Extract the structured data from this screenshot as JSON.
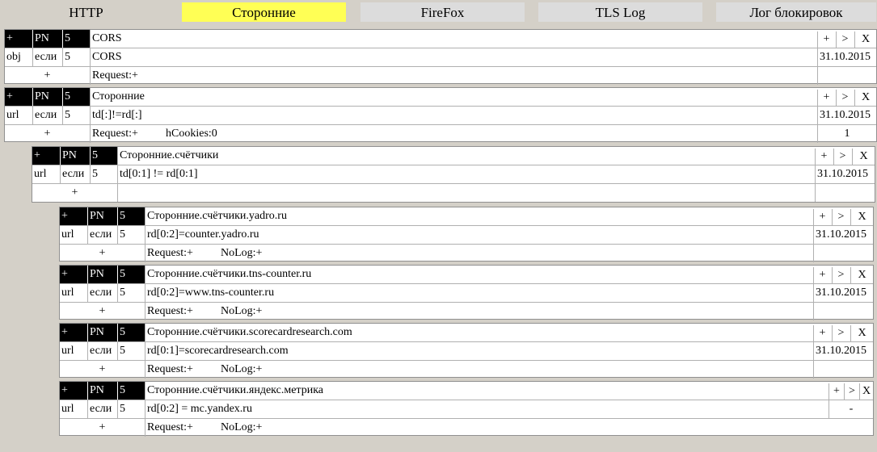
{
  "tabs": [
    {
      "label": "HTTP"
    },
    {
      "label": "Сторонние"
    },
    {
      "label": "FireFox"
    },
    {
      "label": "TLS Log"
    },
    {
      "label": "Лог блокировок"
    }
  ],
  "rules": [
    {
      "header": {
        "plus": "+",
        "pn": "PN",
        "num": "5",
        "name": "CORS",
        "btn_add": "+",
        "btn_next": ">",
        "btn_del": "X"
      },
      "cond": {
        "type": "obj",
        "op": "если",
        "num": "5",
        "expr": "CORS",
        "date": "31.10.2015"
      },
      "actions": {
        "plus": "+",
        "request": "Request:+",
        "extra": "",
        "count": ""
      }
    },
    {
      "header": {
        "plus": "+",
        "pn": "PN",
        "num": "5",
        "name": "Сторонние",
        "btn_add": "+",
        "btn_next": ">",
        "btn_del": "X"
      },
      "cond": {
        "type": "url",
        "op": "если",
        "num": "5",
        "expr": "td[:]!=rd[:]",
        "date": "31.10.2015"
      },
      "actions": {
        "plus": "+",
        "request": "Request:+",
        "extra": "hCookies:0",
        "count": "1"
      }
    },
    {
      "header": {
        "plus": "+",
        "pn": "PN",
        "num": "5",
        "name": "Сторонние.счётчики",
        "btn_add": "+",
        "btn_next": ">",
        "btn_del": "X"
      },
      "cond": {
        "type": "url",
        "op": "если",
        "num": "5",
        "expr": "td[0:1] != rd[0:1]",
        "date": "31.10.2015"
      },
      "actions": {
        "plus": "+",
        "request": "",
        "extra": "",
        "count": ""
      }
    },
    {
      "header": {
        "plus": "+",
        "pn": "PN",
        "num": "5",
        "name": "Сторонние.счётчики.yadro.ru",
        "btn_add": "+",
        "btn_next": ">",
        "btn_del": "X"
      },
      "cond": {
        "type": "url",
        "op": "если",
        "num": "5",
        "expr": "rd[0:2]=counter.yadro.ru",
        "date": "31.10.2015"
      },
      "actions": {
        "plus": "+",
        "request": "Request:+",
        "extra": "NoLog:+",
        "count": ""
      }
    },
    {
      "header": {
        "plus": "+",
        "pn": "PN",
        "num": "5",
        "name": "Сторонние.счётчики.tns-counter.ru",
        "btn_add": "+",
        "btn_next": ">",
        "btn_del": "X"
      },
      "cond": {
        "type": "url",
        "op": "если",
        "num": "5",
        "expr": "rd[0:2]=www.tns-counter.ru",
        "date": "31.10.2015"
      },
      "actions": {
        "plus": "+",
        "request": "Request:+",
        "extra": "NoLog:+",
        "count": ""
      }
    },
    {
      "header": {
        "plus": "+",
        "pn": "PN",
        "num": "5",
        "name": "Сторонние.счётчики.scorecardresearch.com",
        "btn_add": "+",
        "btn_next": ">",
        "btn_del": "X"
      },
      "cond": {
        "type": "url",
        "op": "если",
        "num": "5",
        "expr": "rd[0:1]=scorecardresearch.com",
        "date": "31.10.2015"
      },
      "actions": {
        "plus": "+",
        "request": "Request:+",
        "extra": "NoLog:+",
        "count": ""
      }
    },
    {
      "header": {
        "plus": "+",
        "pn": "PN",
        "num": "5",
        "name": "Сторонние.счётчики.яндекс.метрика",
        "btn_add": "+",
        "btn_next": ">",
        "btn_del": "X"
      },
      "cond": {
        "type": "url",
        "op": "если",
        "num": "5",
        "expr": "rd[0:2] = mc.yandex.ru",
        "date": "-"
      },
      "actions": {
        "plus": "+",
        "request": "Request:+",
        "extra": "NoLog:+",
        "count": ""
      }
    }
  ]
}
